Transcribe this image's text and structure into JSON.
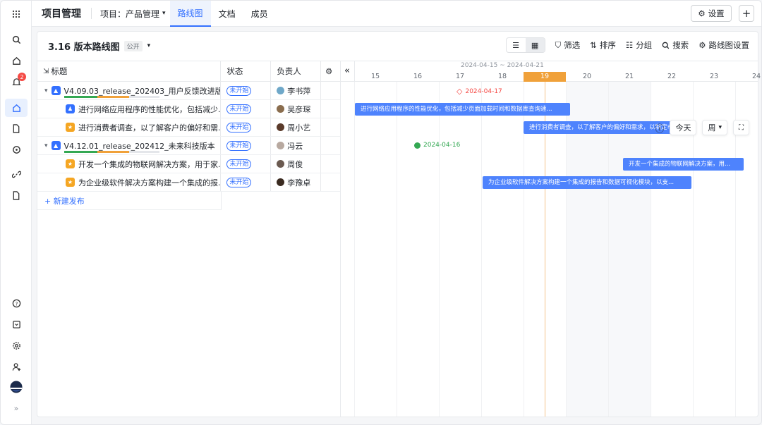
{
  "rail": {
    "notification_count": "2",
    "expand_glyph": "»"
  },
  "topbar": {
    "app_title": "项目管理",
    "project_label": "项目：产品管理",
    "tabs": [
      {
        "label": "路线图",
        "active": true
      },
      {
        "label": "文档",
        "active": false
      },
      {
        "label": "成员",
        "active": false
      }
    ],
    "settings_label": "设置",
    "add_label": "+"
  },
  "panel": {
    "title": "3.16 版本路线图",
    "visibility_tag": "公开",
    "tools": {
      "filter": "筛选",
      "sort": "排序",
      "group": "分组",
      "search": "搜索",
      "roadmap_settings": "路线图设置"
    }
  },
  "table": {
    "headers": {
      "title": "标题",
      "status": "状态",
      "owner": "负责人"
    },
    "rows": [
      {
        "title": "V4.09.03_release_202403_用户反馈改进版...",
        "status": "未开始",
        "owner": "李书萍",
        "level": 0,
        "icon_color": "#3370ff",
        "avatar_color": "#6fa8c9",
        "progress": [
          0.35,
          0.33
        ]
      },
      {
        "title": "进行网络应用程序的性能优化，包括减少...",
        "status": "未开始",
        "owner": "吴彦琛",
        "level": 1,
        "icon_color": "#3370ff",
        "avatar_color": "#8a6d4e"
      },
      {
        "title": "进行消费者调查，以了解客户的偏好和需...",
        "status": "未开始",
        "owner": "周小艺",
        "level": 1,
        "icon_color": "#f5a623",
        "avatar_color": "#5a3a2a"
      },
      {
        "title": "V4.12.01_release_202412_未来科技版本",
        "status": "未开始",
        "owner": "冯云",
        "level": 0,
        "icon_color": "#3370ff",
        "avatar_color": "#b8a9a0",
        "progress": [
          0.35,
          0.33
        ]
      },
      {
        "title": "开发一个集成的物联网解决方案，用于家...",
        "status": "未开始",
        "owner": "周俊",
        "level": 1,
        "icon_color": "#f5a623",
        "avatar_color": "#6b5a50"
      },
      {
        "title": "为企业级软件解决方案构建一个集成的报...",
        "status": "未开始",
        "owner": "李豫卓",
        "level": 1,
        "icon_color": "#f5a623",
        "avatar_color": "#3a2a20"
      }
    ],
    "add_release": "+ 新建发布"
  },
  "gantt": {
    "range_label": "2024-04-15 ~ 2024-04-21",
    "days": [
      "15",
      "16",
      "17",
      "18",
      "19",
      "20",
      "21",
      "22",
      "23",
      "24"
    ],
    "today_index": 4,
    "milestone_1": "2024-04-17",
    "milestone_2": "2024-04-16",
    "bars": [
      {
        "label": "进行网络应用程序的性能优化，包括减少页面加载时间和数据库查询速..."
      },
      {
        "label": "进行消费者调查，以了解客户的偏好和需求，以制定市..."
      },
      {
        "label": "开发一个集成的物联网解决方案，用..."
      },
      {
        "label": "为企业级软件解决方案构建一个集成的报告和数据可视化模块，以支..."
      }
    ],
    "controls": {
      "today": "今天",
      "unit": "周"
    }
  },
  "colors": {
    "accent": "#3370ff",
    "today": "#f0a13a",
    "bar": "#4e83fd",
    "milestone_red": "#f54a45",
    "milestone_green": "#34a853"
  }
}
